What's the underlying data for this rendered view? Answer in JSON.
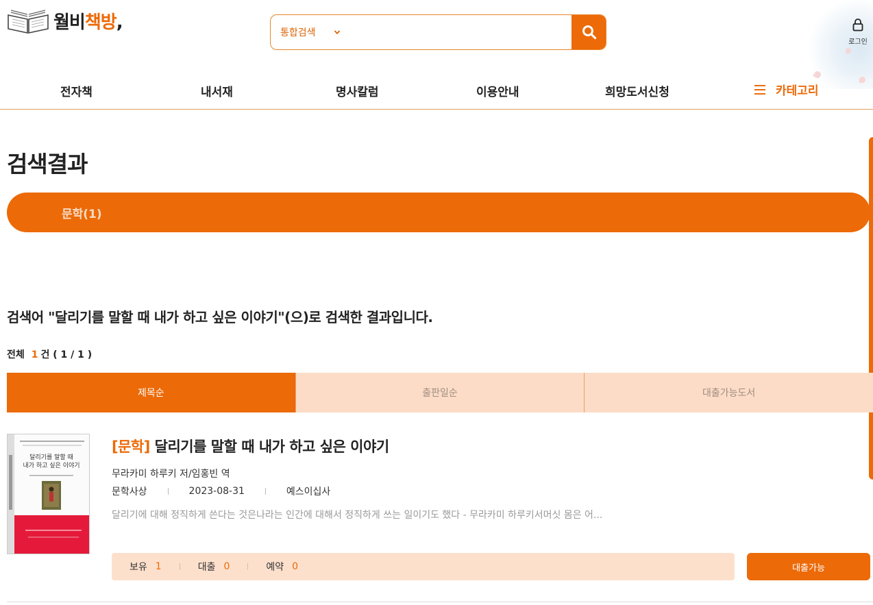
{
  "header": {
    "logo_main": "월비",
    "logo_accent": "책방",
    "logo_comma": ","
  },
  "search": {
    "scope_label": "통합검색",
    "query": "",
    "placeholder": ""
  },
  "login": {
    "label": "로그인"
  },
  "nav": {
    "items": [
      "전자책",
      "내서재",
      "명사칼럼",
      "이용안내",
      "희망도서신청"
    ],
    "category_label": "카테고리"
  },
  "main": {
    "page_title": "검색결과",
    "category_tab": "문학(1)",
    "result_message": "검색어 \"달리기를 말할 때 내가 하고 싶은 이야기\"(으)로 검색한 결과입니다.",
    "count_label": "전체",
    "count_value": "1",
    "count_suffix": "건 ( 1 / 1 )",
    "sort_tabs": [
      "제목순",
      "출판일순",
      "대출가능도서"
    ]
  },
  "book": {
    "category": "[문학]",
    "title": "달리기를 말할 때 내가 하고 싶은 이야기",
    "author": "무라카미 하루키 저/임홍빈 역",
    "genre": "문학사상",
    "date": "2023-08-31",
    "publisher": "예스이십사",
    "description": "달리기에 대해 정직하게 쓴다는 것은나라는 인간에 대해서 정직하게 쓰는 일이기도 했다 - 무라카미 하루키서머싯 몸은 어...",
    "holdings_label": "보유",
    "holdings_value": "1",
    "loaned_label": "대출",
    "loaned_value": "0",
    "reserved_label": "예약",
    "reserved_value": "0",
    "loan_button": "대출가능",
    "cover_title_line1": "달리기를 말할 때",
    "cover_title_line2": "내가 하고 싶은 이야기"
  },
  "colors": {
    "accent": "#ec6a08",
    "accent_light": "#fcdcc7"
  }
}
